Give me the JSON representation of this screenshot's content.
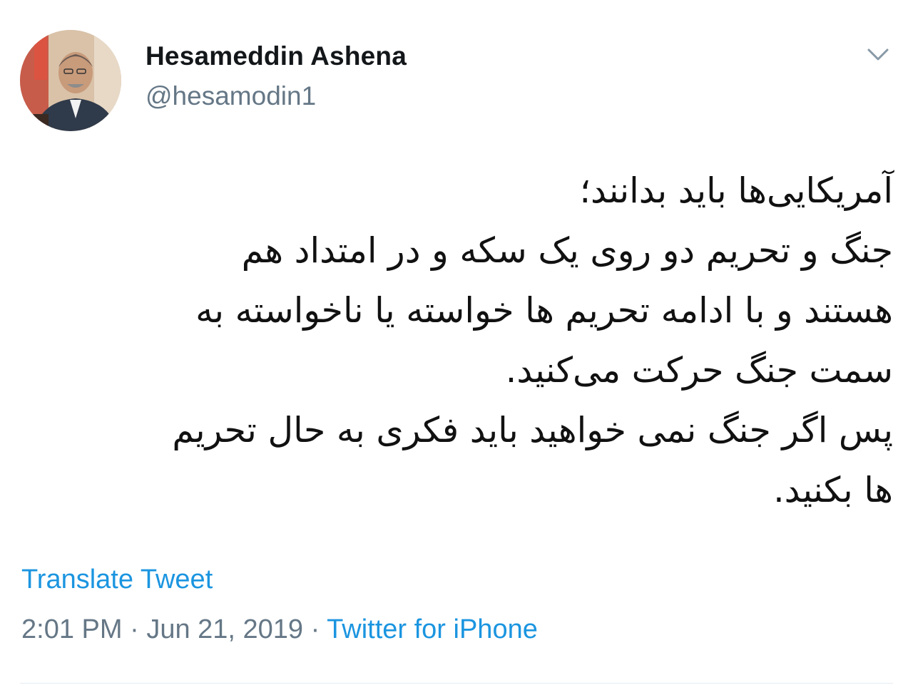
{
  "tweet": {
    "author": {
      "name": "Hesameddin Ashena",
      "handle": "@hesamodin1"
    },
    "menu_icon": "chevron-down-icon",
    "text_lines": [
      "آمریکایی‌ها باید بدانند؛",
      "جنگ و تحریم دو روی یک سکه و  در امتداد هم",
      "هستند و  با ادامه تحریم ها  خواسته یا ناخواسته به",
      "سمت جنگ حرکت می‌کنید.",
      "پس اگر جنگ نمی خواهید باید فکری به حال تحریم",
      "ها بکنید."
    ],
    "translate_label": "Translate Tweet",
    "time": "2:01 PM",
    "separator": "·",
    "date": "Jun 21, 2019",
    "source": "Twitter for iPhone",
    "colors": {
      "link": "#1b95e0",
      "secondary_text": "#657786",
      "primary_text": "#14171a"
    }
  }
}
